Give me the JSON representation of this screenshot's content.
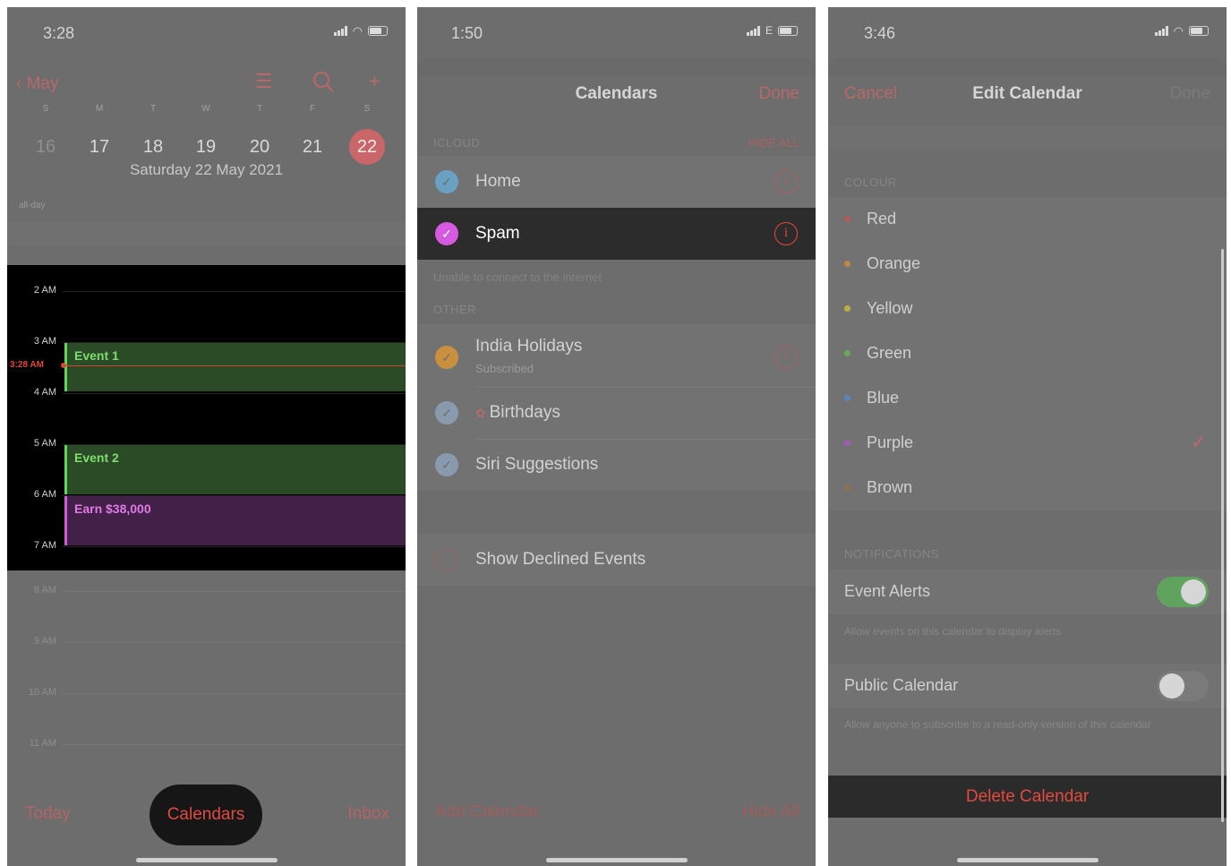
{
  "panel1": {
    "status_time": "3:28",
    "back_label": "May",
    "weekdays": [
      "S",
      "M",
      "T",
      "W",
      "T",
      "F",
      "S"
    ],
    "days": [
      "16",
      "17",
      "18",
      "19",
      "20",
      "21",
      "22"
    ],
    "selected_day_index": 6,
    "date_label": "Saturday  22 May 2021",
    "allday_label": "all-day",
    "hours": [
      "2 AM",
      "3 AM",
      "4 AM",
      "5 AM",
      "6 AM",
      "7 AM"
    ],
    "now_label": "3:28 AM",
    "events": [
      "Event 1",
      "Event 2",
      "Earn $38,000"
    ],
    "dim_hours": [
      "8 AM",
      "9 AM",
      "10 AM",
      "11 AM"
    ],
    "tab_today": "Today",
    "tab_calendars": "Calendars",
    "tab_inbox": "Inbox",
    "colors": {
      "event_green": "#5ed65a",
      "event_purple": "#d05ad8",
      "accent": "#e24a3f"
    }
  },
  "panel2": {
    "status_time": "1:50",
    "status_network": "E",
    "title": "Calendars",
    "done_label": "Done",
    "icloud_header": "ICLOUD",
    "hide_all_link": "HIDE ALL",
    "calendars": [
      {
        "label": "Home",
        "color": "#6aa0c2",
        "selected": false
      },
      {
        "label": "Spam",
        "color": "#d65ae0",
        "selected": true
      }
    ],
    "icloud_note": "Unable to connect to the internet",
    "other_header": "OTHER",
    "other_calendars": [
      {
        "label": "India Holidays",
        "sub": "Subscribed",
        "color": "#c9913f"
      },
      {
        "label": "Birthdays",
        "color": "#8a9aae"
      },
      {
        "label": "Siri Suggestions",
        "color": "#8a9aae"
      }
    ],
    "show_declined": "Show Declined Events",
    "add_calendar": "Add Calendar",
    "hide_all_bottom": "Hide All"
  },
  "panel3": {
    "status_time": "3:46",
    "cancel_label": "Cancel",
    "title": "Edit Calendar",
    "done_label": "Done",
    "colour_header": "COLOUR",
    "colours": [
      {
        "label": "Red",
        "dot": "#b65a5a"
      },
      {
        "label": "Orange",
        "dot": "#c2863e"
      },
      {
        "label": "Yellow",
        "dot": "#c2ae3e"
      },
      {
        "label": "Green",
        "dot": "#6ca85a"
      },
      {
        "label": "Blue",
        "dot": "#5a86c0"
      },
      {
        "label": "Purple",
        "dot": "#a05ab4",
        "selected": true
      },
      {
        "label": "Brown",
        "dot": "#8e7250"
      }
    ],
    "notifications_header": "NOTIFICATIONS",
    "event_alerts_label": "Event Alerts",
    "event_alerts_on": true,
    "event_alerts_foot": "Allow events on this calendar to display alerts",
    "public_calendar_label": "Public Calendar",
    "public_calendar_on": false,
    "public_calendar_foot": "Allow anyone to subscribe to a read-only version of this calendar",
    "delete_label": "Delete Calendar"
  }
}
